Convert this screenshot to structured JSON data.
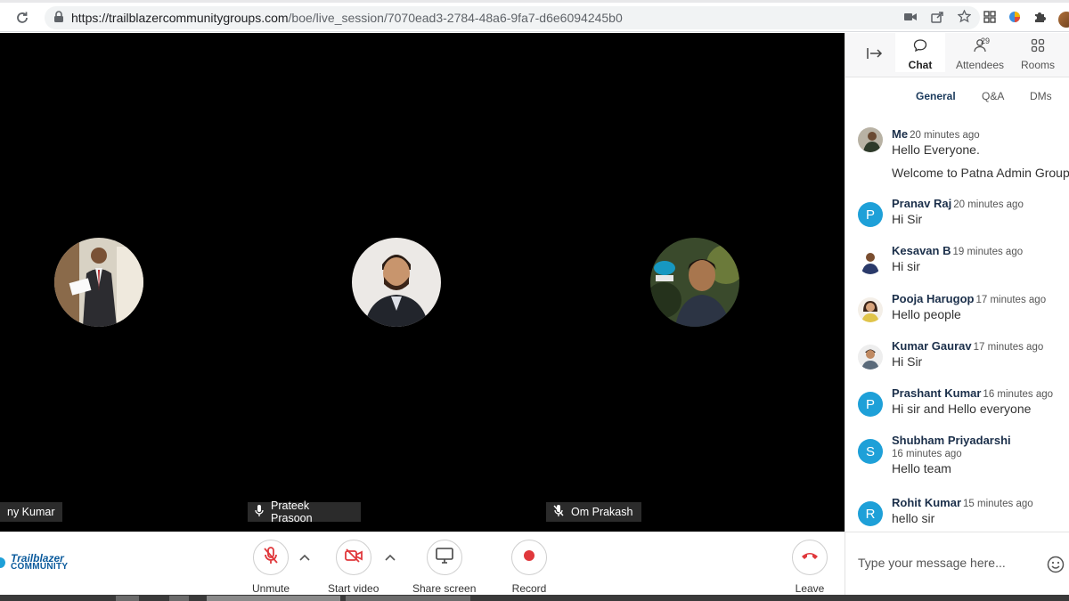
{
  "browser": {
    "url_host": "https://trailblazercommunitygroups.com",
    "url_path": "/boe/live_session/7070ead3-2784-48a6-9fa7-d6e6094245b0"
  },
  "stage": {
    "participants": [
      {
        "name": "ny Kumar",
        "mic": "none"
      },
      {
        "name": "Prateek Prasoon",
        "mic": "on"
      },
      {
        "name": "Om Prakash",
        "mic": "muted"
      }
    ]
  },
  "toolbar": {
    "brand_line1": "Trailblazer",
    "brand_line2": "COMMUNITY",
    "unmute": "Unmute",
    "start_video": "Start video",
    "share_screen": "Share screen",
    "record": "Record",
    "leave": "Leave"
  },
  "panel": {
    "tabs": [
      {
        "label": "Chat",
        "icon": "chat-bubble-icon",
        "active": true
      },
      {
        "label": "Attendees",
        "icon": "person-icon",
        "badge": "29"
      },
      {
        "label": "Rooms",
        "icon": "grid-icon"
      }
    ],
    "subtabs": [
      {
        "label": "General",
        "active": true
      },
      {
        "label": "Q&A"
      },
      {
        "label": "DMs"
      }
    ],
    "messages": [
      {
        "name": "Me",
        "time": "20 minutes ago",
        "text": "Hello Everyone.",
        "text2": "Welcome to Patna Admin Group"
      },
      {
        "name": "Pranav Raj",
        "time": "20 minutes ago",
        "text": "Hi Sir",
        "letter": "P"
      },
      {
        "name": "Kesavan B",
        "time": "19 minutes ago",
        "text": "Hi sir"
      },
      {
        "name": "Pooja Harugop",
        "time": "17 minutes ago",
        "text": "Hello people"
      },
      {
        "name": "Kumar Gaurav",
        "time": "17 minutes ago",
        "text": "Hi Sir"
      },
      {
        "name": "Prashant Kumar",
        "time": "16 minutes ago",
        "text": "Hi sir and Hello everyone",
        "letter": "P"
      },
      {
        "name": "Shubham Priyadarshi",
        "time": "16 minutes ago",
        "text": "Hello team",
        "letter": "S"
      },
      {
        "name": "Rohit Kumar",
        "time": "15 minutes ago",
        "text": "hello sir",
        "letter": "R"
      }
    ],
    "compose_placeholder": "Type your message here..."
  },
  "colors": {
    "accent": "#1ea0d8",
    "danger": "#e0383c",
    "name_text": "#1b2f4a"
  }
}
